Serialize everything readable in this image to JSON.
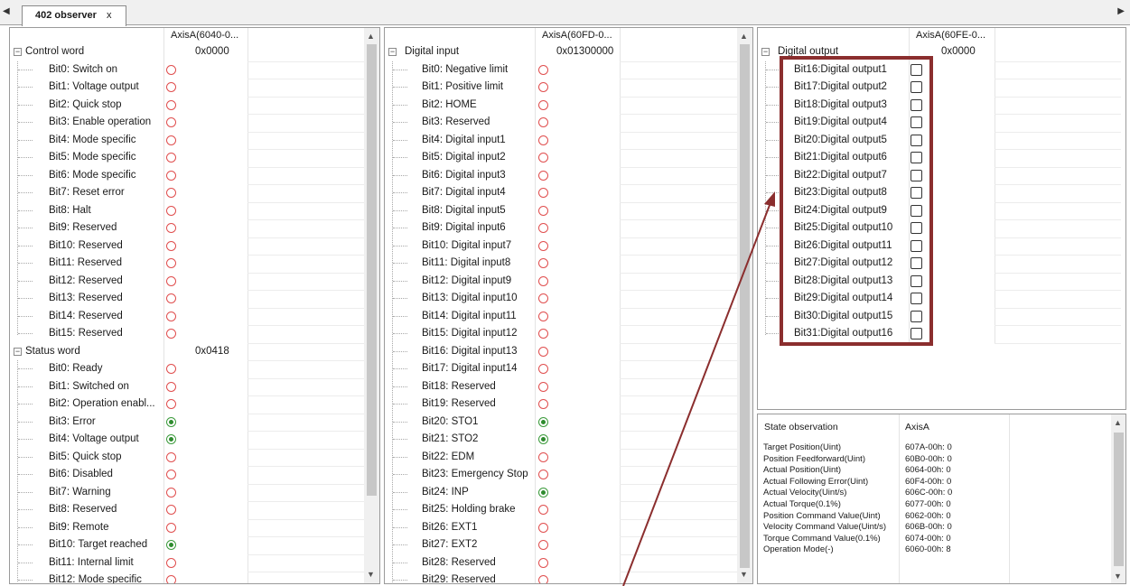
{
  "tabbar": {
    "tab_label": "402 observer",
    "close_label": "x",
    "left_arrow": "◀",
    "right_arrow": "▶"
  },
  "panel_left": {
    "axis_header": "AxisA(6040-0...",
    "groups": [
      {
        "label": "Control word",
        "value": "0x0000",
        "bits": [
          {
            "label": "Bit0: Switch on",
            "state": "off"
          },
          {
            "label": "Bit1: Voltage output",
            "state": "off"
          },
          {
            "label": "Bit2: Quick stop",
            "state": "off"
          },
          {
            "label": "Bit3: Enable operation",
            "state": "off"
          },
          {
            "label": "Bit4: Mode specific",
            "state": "off"
          },
          {
            "label": "Bit5: Mode specific",
            "state": "off"
          },
          {
            "label": "Bit6: Mode specific",
            "state": "off"
          },
          {
            "label": "Bit7: Reset error",
            "state": "off"
          },
          {
            "label": "Bit8: Halt",
            "state": "off"
          },
          {
            "label": "Bit9: Reserved",
            "state": "off"
          },
          {
            "label": "Bit10: Reserved",
            "state": "off"
          },
          {
            "label": "Bit11: Reserved",
            "state": "off"
          },
          {
            "label": "Bit12: Reserved",
            "state": "off"
          },
          {
            "label": "Bit13: Reserved",
            "state": "off"
          },
          {
            "label": "Bit14: Reserved",
            "state": "off"
          },
          {
            "label": "Bit15: Reserved",
            "state": "off"
          }
        ]
      },
      {
        "label": "Status word",
        "value": "0x0418",
        "bits": [
          {
            "label": "Bit0: Ready",
            "state": "off"
          },
          {
            "label": "Bit1: Switched on",
            "state": "off"
          },
          {
            "label": "Bit2: Operation enabl...",
            "state": "off"
          },
          {
            "label": "Bit3: Error",
            "state": "on"
          },
          {
            "label": "Bit4: Voltage output",
            "state": "on"
          },
          {
            "label": "Bit5: Quick stop",
            "state": "off"
          },
          {
            "label": "Bit6: Disabled",
            "state": "off"
          },
          {
            "label": "Bit7: Warning",
            "state": "off"
          },
          {
            "label": "Bit8: Reserved",
            "state": "off"
          },
          {
            "label": "Bit9: Remote",
            "state": "off"
          },
          {
            "label": "Bit10: Target reached",
            "state": "on"
          },
          {
            "label": "Bit11: Internal limit",
            "state": "off"
          },
          {
            "label": "Bit12: Mode specific",
            "state": "off"
          }
        ]
      }
    ]
  },
  "panel_middle": {
    "axis_header": "AxisA(60FD-0...",
    "group_label": "Digital input",
    "group_value": "0x01300000",
    "bits": [
      {
        "label": "Bit0: Negative limit",
        "state": "off"
      },
      {
        "label": "Bit1: Positive limit",
        "state": "off"
      },
      {
        "label": "Bit2: HOME",
        "state": "off"
      },
      {
        "label": "Bit3: Reserved",
        "state": "off"
      },
      {
        "label": "Bit4: Digital input1",
        "state": "off"
      },
      {
        "label": "Bit5: Digital input2",
        "state": "off"
      },
      {
        "label": "Bit6: Digital input3",
        "state": "off"
      },
      {
        "label": "Bit7: Digital input4",
        "state": "off"
      },
      {
        "label": "Bit8: Digital input5",
        "state": "off"
      },
      {
        "label": "Bit9: Digital input6",
        "state": "off"
      },
      {
        "label": "Bit10: Digital input7",
        "state": "off"
      },
      {
        "label": "Bit11: Digital input8",
        "state": "off"
      },
      {
        "label": "Bit12: Digital input9",
        "state": "off"
      },
      {
        "label": "Bit13: Digital input10",
        "state": "off"
      },
      {
        "label": "Bit14: Digital input11",
        "state": "off"
      },
      {
        "label": "Bit15: Digital input12",
        "state": "off"
      },
      {
        "label": "Bit16: Digital input13",
        "state": "off"
      },
      {
        "label": "Bit17: Digital input14",
        "state": "off"
      },
      {
        "label": "Bit18: Reserved",
        "state": "off"
      },
      {
        "label": "Bit19: Reserved",
        "state": "off"
      },
      {
        "label": "Bit20: STO1",
        "state": "on"
      },
      {
        "label": "Bit21: STO2",
        "state": "on"
      },
      {
        "label": "Bit22: EDM",
        "state": "off"
      },
      {
        "label": "Bit23: Emergency Stop",
        "state": "off"
      },
      {
        "label": "Bit24: INP",
        "state": "on"
      },
      {
        "label": "Bit25: Holding brake",
        "state": "off"
      },
      {
        "label": "Bit26: EXT1",
        "state": "off"
      },
      {
        "label": "Bit27: EXT2",
        "state": "off"
      },
      {
        "label": "Bit28: Reserved",
        "state": "off"
      },
      {
        "label": "Bit29: Reserved",
        "state": "off"
      }
    ]
  },
  "panel_right": {
    "axis_header": "AxisA(60FE-0...",
    "group_label": "Digital output",
    "group_value": "0x0000",
    "bits": [
      {
        "label": "Bit16:Digital output1",
        "checked": false
      },
      {
        "label": "Bit17:Digital output2",
        "checked": false
      },
      {
        "label": "Bit18:Digital output3",
        "checked": false
      },
      {
        "label": "Bit19:Digital output4",
        "checked": false
      },
      {
        "label": "Bit20:Digital output5",
        "checked": false
      },
      {
        "label": "Bit21:Digital output6",
        "checked": false
      },
      {
        "label": "Bit22:Digital output7",
        "checked": false
      },
      {
        "label": "Bit23:Digital output8",
        "checked": false
      },
      {
        "label": "Bit24:Digital output9",
        "checked": false
      },
      {
        "label": "Bit25:Digital output10",
        "checked": false
      },
      {
        "label": "Bit26:Digital output11",
        "checked": false
      },
      {
        "label": "Bit27:Digital output12",
        "checked": false
      },
      {
        "label": "Bit28:Digital output13",
        "checked": false
      },
      {
        "label": "Bit29:Digital output14",
        "checked": false
      },
      {
        "label": "Bit30:Digital output15",
        "checked": false
      },
      {
        "label": "Bit31:Digital output16",
        "checked": false
      }
    ]
  },
  "state_observation": {
    "header_label": "State observation",
    "header_axis": "AxisA",
    "rows": [
      {
        "label": "Target Position(Uint)",
        "value": "607A-00h: 0"
      },
      {
        "label": "Position Feedforward(Uint)",
        "value": "60B0-00h: 0"
      },
      {
        "label": "Actual Position(Uint)",
        "value": "6064-00h: 0"
      },
      {
        "label": "Actual Following Error(Uint)",
        "value": "60F4-00h: 0"
      },
      {
        "label": "Actual Velocity(Uint/s)",
        "value": "606C-00h: 0"
      },
      {
        "label": "Actual Torque(0.1%)",
        "value": "6077-00h: 0"
      },
      {
        "label": "Position Command Value(Uint)",
        "value": "6062-00h: 0"
      },
      {
        "label": "Velocity Command Value(Uint/s)",
        "value": "606B-00h: 0"
      },
      {
        "label": "Torque Command Value(0.1%)",
        "value": "6074-00h: 0"
      },
      {
        "label": "Operation Mode(-)",
        "value": "6060-00h: 8"
      }
    ]
  },
  "colors": {
    "highlight_box": "#8b2e2e",
    "radio_off": "#e04e4e",
    "radio_on": "#2e8b2e"
  }
}
